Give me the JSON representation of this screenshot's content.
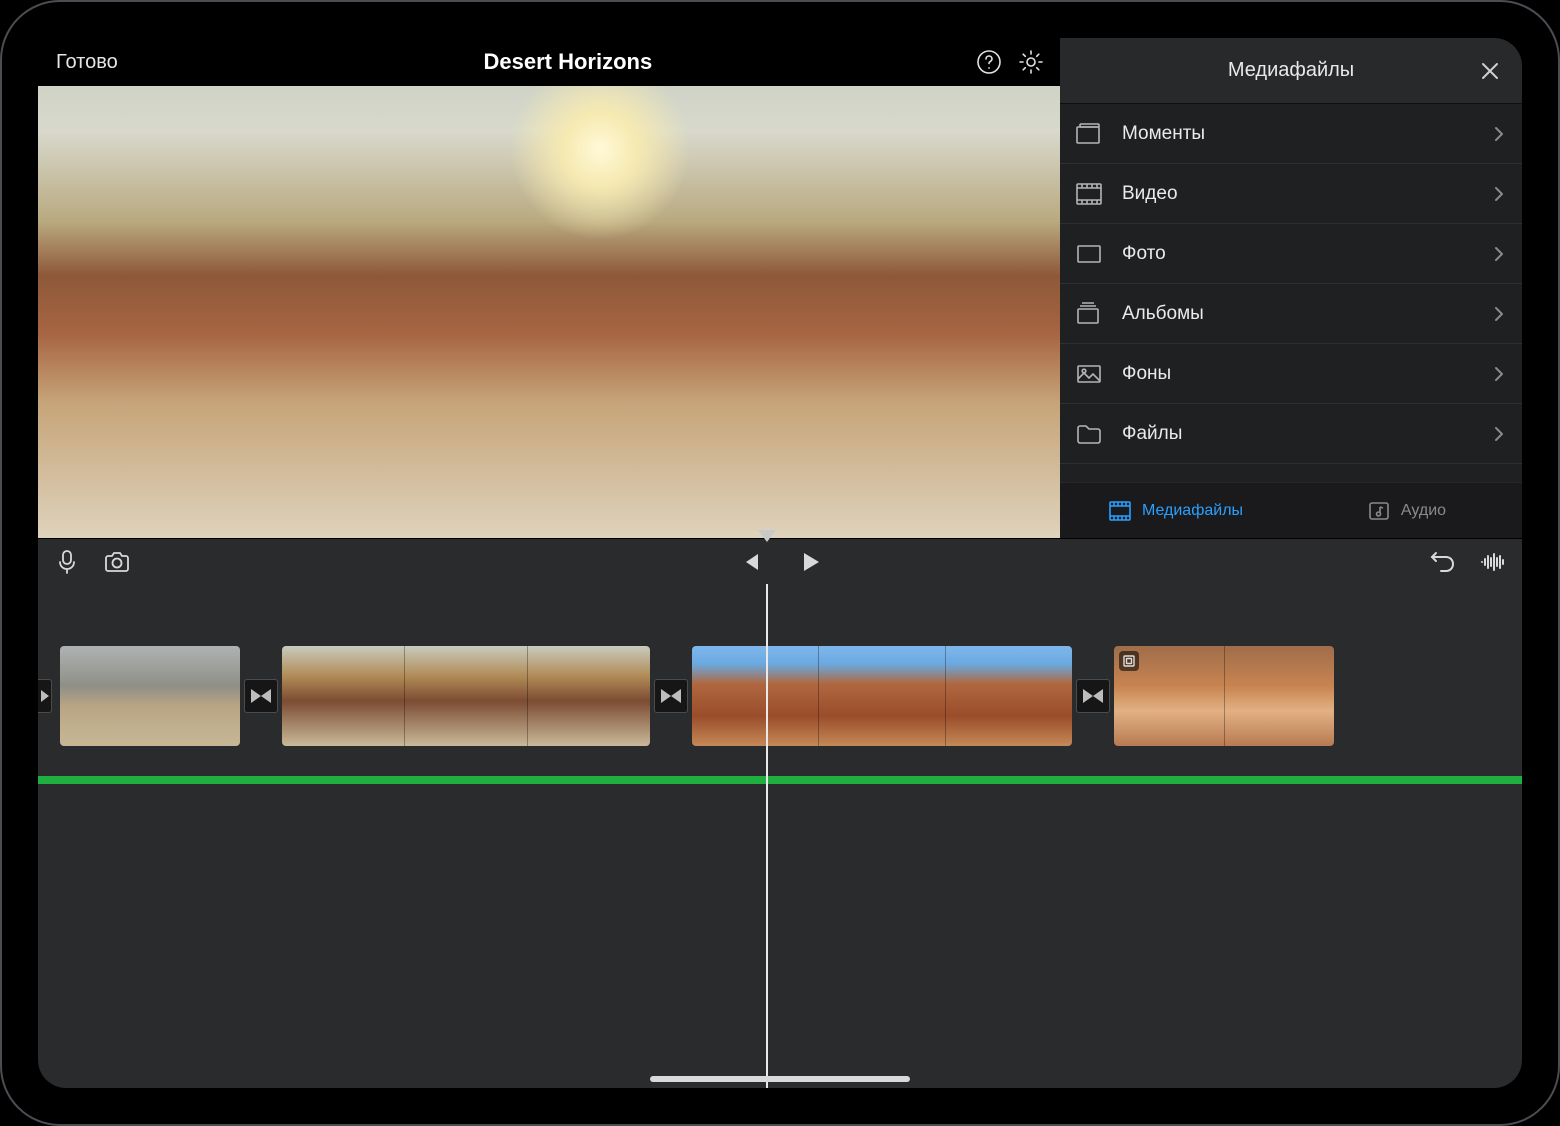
{
  "header": {
    "done_label": "Готово",
    "project_title": "Desert Horizons"
  },
  "media_panel": {
    "title": "Медиафайлы",
    "items": [
      {
        "label": "Моменты",
        "icon": "moments-icon"
      },
      {
        "label": "Видео",
        "icon": "video-icon"
      },
      {
        "label": "Фото",
        "icon": "photo-icon"
      },
      {
        "label": "Альбомы",
        "icon": "albums-icon"
      },
      {
        "label": "Фоны",
        "icon": "backgrounds-icon"
      },
      {
        "label": "Файлы",
        "icon": "files-icon"
      }
    ],
    "tabs": {
      "media": "Медиафайлы",
      "audio": "Аудио"
    }
  },
  "colors": {
    "accent": "#2aa0ff",
    "audio_track": "#1fae3f"
  }
}
